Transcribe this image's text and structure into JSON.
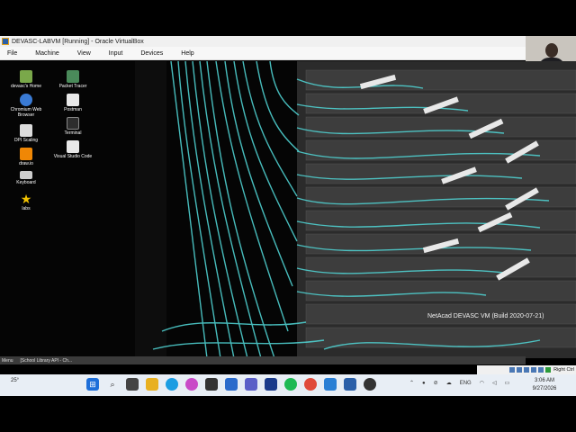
{
  "vbox": {
    "title": "DEVASC-LABVM [Running] - Oracle VirtualBox",
    "menu": [
      "File",
      "Machine",
      "View",
      "Input",
      "Devices",
      "Help"
    ],
    "host_key": "Right Ctrl"
  },
  "desktop": {
    "icons": [
      {
        "label": "devasc's Home",
        "icon": "folder-icon",
        "color": "#7aa84a"
      },
      {
        "label": "Packet Tracer",
        "icon": "packet-tracer-icon",
        "color": "#4a8a5a"
      },
      {
        "label": "Chromium Web Browser",
        "icon": "chromium-icon",
        "color": "#3a7bd5"
      },
      {
        "label": "Postman",
        "icon": "file-icon",
        "color": "#e8e8e8"
      },
      {
        "label": "DPI Scaling",
        "icon": "display-icon",
        "color": "#dddddd"
      },
      {
        "label": "Terminal",
        "icon": "terminal-icon",
        "color": "#2d2d2d"
      },
      {
        "label": "draw.io",
        "icon": "drawio-icon",
        "color": "#f08705"
      },
      {
        "label": "Visual Studio Code",
        "icon": "file-icon",
        "color": "#e8e8e8"
      },
      {
        "label": "Keyboard",
        "icon": "keyboard-icon",
        "color": "#cccccc"
      },
      {
        "label": "labs",
        "icon": "star-icon",
        "color": "#f2c200"
      }
    ],
    "watermark": "NetAcad DEVASC VM (Build 2020-07-21)"
  },
  "guest_taskbar": {
    "menu_label": "Menu",
    "window_label": "[School Library API - Ch..."
  },
  "taskbar": {
    "weather": "25°",
    "lang": "ENG",
    "time": "3:06 AM",
    "date": "9/27/2026",
    "apps": [
      {
        "icon": "windows-start-icon",
        "color": "#1e6fd9"
      },
      {
        "icon": "search-icon",
        "color": "#444444"
      },
      {
        "icon": "task-view-icon",
        "color": "#444444"
      },
      {
        "icon": "file-explorer-icon",
        "color": "#e8b020"
      },
      {
        "icon": "edge-icon",
        "color": "#1b9de2"
      },
      {
        "icon": "copilot-icon",
        "color": "#c94ac7"
      },
      {
        "icon": "terminal-icon",
        "color": "#333333"
      },
      {
        "icon": "mail-icon",
        "color": "#2a6acb"
      },
      {
        "icon": "teams-icon",
        "color": "#5b5fc7"
      },
      {
        "icon": "zoom-icon",
        "color": "#1a3a8a"
      },
      {
        "icon": "spotify-icon",
        "color": "#1db954"
      },
      {
        "icon": "chrome-icon",
        "color": "#e04a3a"
      },
      {
        "icon": "vscode-icon",
        "color": "#2a7fd4"
      },
      {
        "icon": "virtualbox-icon",
        "color": "#2a5fa8"
      },
      {
        "icon": "obs-icon",
        "color": "#333333"
      }
    ]
  }
}
